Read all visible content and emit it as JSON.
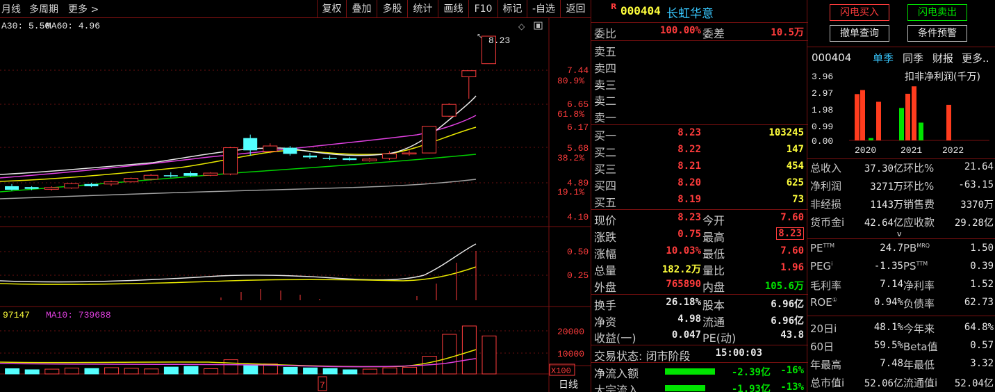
{
  "toolbar": {
    "period": "月线",
    "multi_period": "多周期",
    "more": "更多",
    "buttons": [
      "复权",
      "叠加",
      "多股",
      "统计",
      "画线",
      "F10",
      "标记",
      "-自选",
      "返回"
    ]
  },
  "chart": {
    "ma_legend_1": "A30: 5.50",
    "ma_legend_2": "MA60: 4.96",
    "vol_legend_1": "97147",
    "vol_legend_2": "MA10: 739688",
    "price_high_label": "8.23",
    "price_axis": [
      "7.44",
      "80.9%",
      "6.65",
      "61.8%",
      "6.17",
      "5.68",
      "38.2%",
      "4.89",
      "19.1%",
      "4.10"
    ],
    "macd_axis": [
      "0.50",
      "0.25"
    ],
    "vol_axis": [
      "20000",
      "10000"
    ],
    "vol_unit": "X100",
    "period_footer": "日线",
    "cursor_label": "7"
  },
  "chart_data": {
    "type": "candlestick",
    "price_candles": [
      {
        "o": 4.8,
        "c": 4.72,
        "h": 4.85,
        "l": 4.7
      },
      {
        "o": 4.78,
        "c": 4.74,
        "h": 4.8,
        "l": 4.71
      },
      {
        "o": 4.73,
        "c": 4.77,
        "h": 4.8,
        "l": 4.7
      },
      {
        "o": 4.76,
        "c": 4.86,
        "h": 4.88,
        "l": 4.74
      },
      {
        "o": 4.85,
        "c": 4.8,
        "h": 4.88,
        "l": 4.78
      },
      {
        "o": 4.85,
        "c": 4.9,
        "h": 4.93,
        "l": 4.8
      },
      {
        "o": 4.9,
        "c": 4.98,
        "h": 5.0,
        "l": 4.88
      },
      {
        "o": 4.96,
        "c": 5.05,
        "h": 5.08,
        "l": 4.93
      },
      {
        "o": 5.05,
        "c": 5.03,
        "h": 5.12,
        "l": 5.0
      },
      {
        "o": 5.1,
        "c": 5.04,
        "h": 5.14,
        "l": 5.02
      },
      {
        "o": 5.05,
        "c": 5.1,
        "h": 5.12,
        "l": 5.03
      },
      {
        "o": 5.08,
        "c": 5.68,
        "h": 5.7,
        "l": 5.05
      },
      {
        "o": 5.9,
        "c": 5.62,
        "h": 5.98,
        "l": 5.5
      },
      {
        "o": 5.6,
        "c": 5.72,
        "h": 5.78,
        "l": 5.55
      },
      {
        "o": 5.68,
        "c": 5.54,
        "h": 5.72,
        "l": 5.5
      },
      {
        "o": 5.5,
        "c": 5.46,
        "h": 5.56,
        "l": 5.42
      },
      {
        "o": 5.45,
        "c": 5.44,
        "h": 5.5,
        "l": 5.4
      },
      {
        "o": 5.44,
        "c": 5.4,
        "h": 5.47,
        "l": 5.38
      },
      {
        "o": 5.38,
        "c": 5.42,
        "h": 5.45,
        "l": 5.36
      },
      {
        "o": 5.44,
        "c": 5.54,
        "h": 5.6,
        "l": 5.4
      },
      {
        "o": 5.54,
        "c": 5.56,
        "h": 5.62,
        "l": 5.5
      },
      {
        "o": 5.56,
        "c": 6.17,
        "h": 6.17,
        "l": 5.55
      },
      {
        "o": 6.4,
        "c": 6.67,
        "h": 6.7,
        "l": 6.38
      },
      {
        "o": 7.3,
        "c": 7.44,
        "h": 7.44,
        "l": 6.8
      },
      {
        "o": 7.6,
        "c": 8.23,
        "h": 8.23,
        "l": 7.6
      }
    ],
    "volumes": [
      3000,
      2500,
      2000,
      2300,
      2800,
      2600,
      3000,
      2700,
      2400,
      3300,
      3600,
      2500,
      6800,
      4400,
      4800,
      3200,
      2900,
      2600,
      2000,
      2300,
      2900,
      3200,
      8500,
      19000,
      23000,
      18220
    ]
  },
  "quote": {
    "badge": "R",
    "code": "000404",
    "name": "长虹华意",
    "weibi_label": "委比",
    "weibi": "100.00%",
    "weicha_label": "委差",
    "weicha": "10.5万",
    "asks": [
      {
        "label": "卖五",
        "price": "",
        "vol": ""
      },
      {
        "label": "卖四",
        "price": "",
        "vol": ""
      },
      {
        "label": "卖三",
        "price": "",
        "vol": ""
      },
      {
        "label": "卖二",
        "price": "",
        "vol": ""
      },
      {
        "label": "卖一",
        "price": "",
        "vol": ""
      }
    ],
    "bids": [
      {
        "label": "买一",
        "price": "8.23",
        "vol": "103245"
      },
      {
        "label": "买二",
        "price": "8.22",
        "vol": "147"
      },
      {
        "label": "买三",
        "price": "8.21",
        "vol": "454"
      },
      {
        "label": "买四",
        "price": "8.20",
        "vol": "625"
      },
      {
        "label": "买五",
        "price": "8.19",
        "vol": "73"
      }
    ],
    "stats": [
      {
        "l1": "现价",
        "v1": "8.23",
        "c1": "red",
        "l2": "今开",
        "v2": "7.60",
        "c2": "red"
      },
      {
        "l1": "涨跌",
        "v1": "0.75",
        "c1": "red",
        "l2": "最高",
        "v2": "8.23",
        "c2": "red"
      },
      {
        "l1": "涨幅",
        "v1": "10.03%",
        "c1": "red",
        "l2": "最低",
        "v2": "7.60",
        "c2": "red"
      },
      {
        "l1": "总量",
        "v1": "182.2万",
        "c1": "yellow",
        "l2": "量比",
        "v2": "1.96",
        "c2": "red"
      },
      {
        "l1": "外盘",
        "v1": "765890",
        "c1": "red",
        "l2": "内盘",
        "v2": "105.6万",
        "c2": "green"
      }
    ],
    "info": [
      {
        "l1": "换手",
        "v1": "26.18%",
        "l2": "股本",
        "v2": "6.96亿"
      },
      {
        "l1": "净资",
        "v1": "4.98",
        "l2": "流通",
        "v2": "6.96亿"
      },
      {
        "l1": "收益(一)",
        "v1": "0.047",
        "l2": "PE(动)",
        "v2": "43.8"
      }
    ],
    "trade_status_label": "交易状态: 闭市阶段",
    "trade_time": "15:00:03",
    "flow": [
      {
        "label": "净流入额",
        "value": "-2.39亿",
        "pct": "-16%"
      },
      {
        "label": "大宗流入",
        "value": "-1.93亿",
        "pct": "-13%"
      }
    ]
  },
  "fin": {
    "btn_buy": "闪电买入",
    "btn_sell": "闪电卖出",
    "btn_cancel": "撤单查询",
    "btn_cond": "条件预警",
    "code": "000404",
    "tabs": [
      "单季",
      "同季",
      "财报",
      "更多.."
    ],
    "chart_title": "扣非净利润(千万)",
    "yaxis": [
      "3.96",
      "2.97",
      "1.98",
      "0.99",
      "0.00"
    ],
    "years": [
      "2020",
      "2021",
      "2022"
    ],
    "rows": [
      {
        "l1": "总收入",
        "v1": "37.30亿",
        "l2": "环比%",
        "v2": "21.64"
      },
      {
        "l1": "净利润",
        "v1": "3271万",
        "l2": "环比%",
        "v2": "-63.15"
      },
      {
        "l1": "非经损",
        "v1": "1143万",
        "l2": "销售费",
        "v2": "3370万"
      },
      {
        "l1": "货币金i",
        "v1": "42.64亿",
        "l2": "应收款",
        "v2": "29.28亿"
      }
    ],
    "chevron": "v",
    "ratios": [
      {
        "l1": "PE",
        "s1": "TTM",
        "v1": "24.7",
        "l2": "PB",
        "s2": "MRQ",
        "v2": "1.50"
      },
      {
        "l1": "PEG",
        "s1": "i",
        "v1": "-1.35",
        "l2": "PS",
        "s2": "TTM",
        "v2": "0.39"
      },
      {
        "l1": "毛利率",
        "s1": "",
        "v1": "7.14",
        "l2": "净利率",
        "s2": "",
        "v2": "1.52"
      },
      {
        "l1": "ROE",
        "s1": "①",
        "v1": "0.94%",
        "l2": "负债率",
        "s2": "",
        "v2": "62.73"
      }
    ],
    "perf": [
      {
        "l1": "20日i",
        "v1": "48.1%",
        "l2": "今年来",
        "v2": "64.8%"
      },
      {
        "l1": "60日",
        "v1": "59.5%",
        "l2": "Beta值",
        "v2": "0.57"
      },
      {
        "l1": "年最高",
        "v1": "7.48",
        "l2": "年最低",
        "v2": "3.32"
      },
      {
        "l1": "总市值i",
        "v1": "52.06亿",
        "l2": "流通值i",
        "v2": "52.04亿"
      }
    ]
  }
}
